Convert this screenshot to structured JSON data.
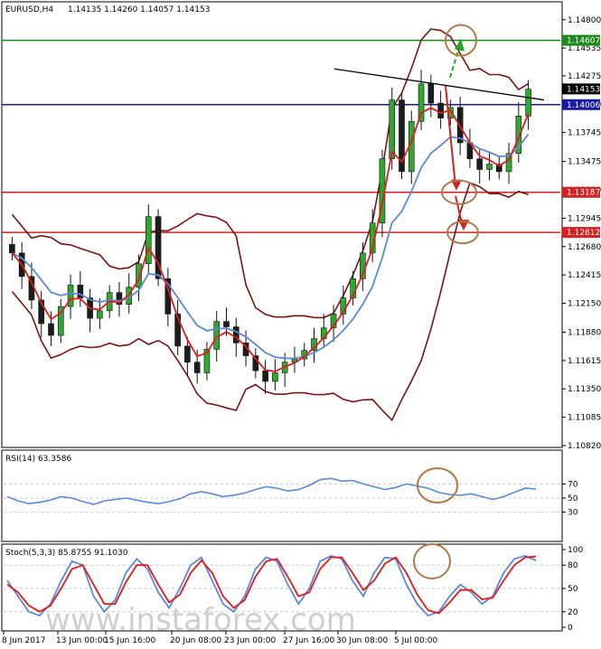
{
  "chart_data": {
    "type": "candlestick",
    "symbol_title": "EURUSD,H4",
    "ohlc": "1.14135 1.14260 1.14057 1.14153",
    "y_ticks": [
      "1.14800",
      "1.14535",
      "1.14275",
      "1.14010",
      "1.13745",
      "1.13475",
      "1.13210",
      "1.12945",
      "1.12680",
      "1.12415",
      "1.12150",
      "1.11880",
      "1.11615",
      "1.11350",
      "1.11085",
      "1.10820"
    ],
    "ylim": [
      1.1082,
      1.1495
    ],
    "x_labels": [
      "8 Jun 2017",
      "13 Jun 00:00",
      "15 Jun 16:00",
      "20 Jun 08:00",
      "23 Jun 00:00",
      "27 Jun 16:00",
      "30 Jun 08:00",
      "5 Jul 00:00"
    ],
    "levels": [
      {
        "value": "1.14607",
        "color": "#1b8a1b"
      },
      {
        "value": "1.14153",
        "color": "#000000"
      },
      {
        "value": "1.14006",
        "color": "#1a1aa0"
      },
      {
        "value": "1.13187",
        "color": "#d42020"
      },
      {
        "value": "1.12812",
        "color": "#d42020"
      }
    ],
    "close_series": [
      1.1262,
      1.124,
      1.1218,
      1.1196,
      1.1185,
      1.1212,
      1.1232,
      1.122,
      1.1201,
      1.1208,
      1.1225,
      1.1214,
      1.123,
      1.1252,
      1.1296,
      1.1238,
      1.1205,
      1.1175,
      1.116,
      1.115,
      1.1172,
      1.1198,
      1.1193,
      1.1178,
      1.1166,
      1.1152,
      1.1142,
      1.115,
      1.116,
      1.1163,
      1.1171,
      1.1182,
      1.1192,
      1.1205,
      1.122,
      1.1238,
      1.1262,
      1.129,
      1.135,
      1.1405,
      1.1338,
      1.1385,
      1.142,
      1.1402,
      1.1388,
      1.1398,
      1.1365,
      1.135,
      1.134,
      1.1345,
      1.1338,
      1.1355,
      1.139,
      1.1415
    ],
    "rsi": {
      "title": "RSI(14) 63.3586",
      "levels": [
        "70",
        "50",
        "30"
      ],
      "ylim": [
        0,
        100
      ],
      "values": [
        52,
        46,
        42,
        44,
        47,
        52,
        50,
        45,
        41,
        46,
        48,
        50,
        47,
        44,
        42,
        45,
        49,
        56,
        59,
        56,
        52,
        54,
        57,
        62,
        66,
        64,
        60,
        62,
        68,
        76,
        78,
        74,
        75,
        70,
        66,
        62,
        65,
        70,
        67,
        64,
        58,
        55,
        54,
        56,
        52,
        48,
        52,
        58,
        64,
        63
      ]
    },
    "stoch": {
      "title": "Stoch(5,3,3) 85.8755 91.1030",
      "levels": [
        "100",
        "80",
        "50",
        "20",
        "0"
      ],
      "ylim": [
        0,
        100
      ],
      "k": [
        60,
        40,
        20,
        15,
        30,
        60,
        85,
        80,
        40,
        20,
        35,
        70,
        88,
        75,
        45,
        25,
        50,
        80,
        90,
        60,
        30,
        20,
        40,
        75,
        90,
        85,
        55,
        30,
        50,
        85,
        92,
        88,
        60,
        40,
        70,
        90,
        88,
        55,
        30,
        15,
        20,
        40,
        55,
        45,
        30,
        40,
        70,
        88,
        92,
        86
      ],
      "d": [
        55,
        45,
        28,
        20,
        28,
        50,
        75,
        80,
        55,
        30,
        30,
        58,
        80,
        80,
        55,
        32,
        42,
        70,
        86,
        70,
        40,
        25,
        35,
        65,
        85,
        88,
        65,
        40,
        45,
        75,
        90,
        90,
        70,
        48,
        60,
        82,
        90,
        70,
        42,
        22,
        18,
        32,
        48,
        48,
        36,
        38,
        60,
        80,
        90,
        91
      ]
    },
    "watermark": "www.instaforex.com"
  }
}
